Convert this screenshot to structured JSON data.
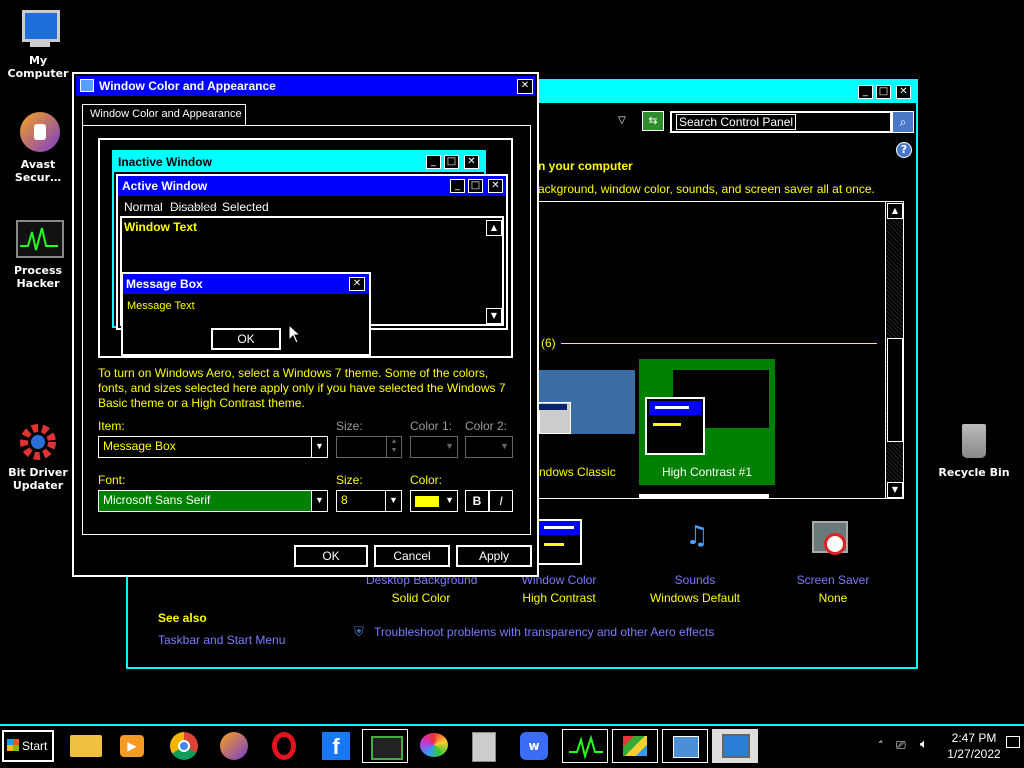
{
  "desktop": {
    "icons": [
      {
        "label": "My Computer"
      },
      {
        "label": "Avast Secur…"
      },
      {
        "label": "Process Hacker"
      },
      {
        "label": "Bit Driver Updater"
      },
      {
        "label": "Recycle Bin"
      }
    ]
  },
  "control_panel": {
    "search_placeholder": "Search Control Panel",
    "heading": "n your computer",
    "subtitle": "ackground, window color, sounds, and screen saver all at once.",
    "group_count": "(6)",
    "themes": [
      {
        "label": "ndows Classic"
      },
      {
        "label": "High Contrast #1"
      }
    ],
    "bottom_items": [
      {
        "title": "Desktop Background",
        "value": "Solid Color"
      },
      {
        "title": "Window Color",
        "value": "High Contrast"
      },
      {
        "title": "Sounds",
        "value": "Windows Default"
      },
      {
        "title": "Screen Saver",
        "value": "None"
      }
    ],
    "see_also": "See also",
    "taskbar_link": "Taskbar and Start Menu",
    "troubleshoot": "Troubleshoot problems with transparency and other Aero effects"
  },
  "dialog": {
    "title": "Window Color and Appearance",
    "tab": "Window Color and Appearance",
    "preview": {
      "inactive_title": "Inactive Window",
      "active_title": "Active Window",
      "menu": [
        "Normal",
        "Disabled",
        "Selected"
      ],
      "window_text": "Window Text",
      "msgbox_title": "Message Box",
      "msgbox_text": "Message Text",
      "msgbox_ok": "OK"
    },
    "info": "To turn on Windows Aero, select a Windows 7 theme.  Some of the colors, fonts, and sizes selected here apply only if you have selected the Windows 7 Basic theme or a High Contrast theme.",
    "item_label": "Item:",
    "item_value": "Message Box",
    "size_label": "Size:",
    "color1_label": "Color 1:",
    "color2_label": "Color 2:",
    "font_label": "Font:",
    "font_value": "Microsoft Sans Serif",
    "font_size_label": "Size:",
    "font_size_value": "8",
    "font_color_label": "Color:",
    "font_color": "#ffff00",
    "bold": "B",
    "italic": "I",
    "ok": "OK",
    "cancel": "Cancel",
    "apply": "Apply"
  },
  "taskbar": {
    "start": "Start",
    "time": "2:47 PM",
    "date": "1/27/2022"
  },
  "colors": {
    "cyan": "#00ffff",
    "blue": "#0000ff",
    "yellow": "#ffff00",
    "green": "#008000"
  }
}
